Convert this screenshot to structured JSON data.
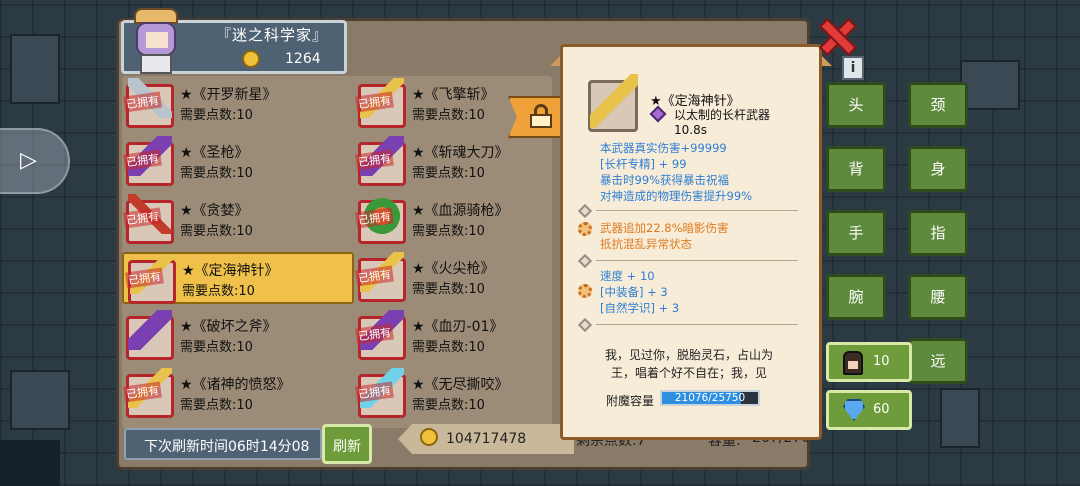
{
  "player": {
    "title": "『迷之科学家』",
    "points": "1264"
  },
  "items": [
    {
      "name": "★《开罗新星》",
      "cost": "需要点数:10",
      "owned": "已拥有",
      "weapon": "w-silver"
    },
    {
      "name": "★《飞擎斩》",
      "cost": "需要点数:10",
      "owned": "已拥有",
      "weapon": "w-gold"
    },
    {
      "name": "★《圣枪》",
      "cost": "需要点数:10",
      "owned": "已拥有",
      "weapon": "w-purple"
    },
    {
      "name": "★《斩魂大刀》",
      "cost": "需要点数:10",
      "owned": "已拥有",
      "weapon": "w-purple"
    },
    {
      "name": "★《贪婪》",
      "cost": "需要点数:10",
      "owned": "已拥有",
      "weapon": "w-red"
    },
    {
      "name": "★《血源骑枪》",
      "cost": "需要点数:10",
      "owned": "已拥有",
      "weapon": "w-green"
    },
    {
      "name": "★《定海神针》",
      "cost": "需要点数:10",
      "owned": "已拥有",
      "weapon": "w-gold"
    },
    {
      "name": "★《火尖枪》",
      "cost": "需要点数:10",
      "owned": "已拥有",
      "weapon": "w-gold"
    },
    {
      "name": "★《破坏之斧》",
      "cost": "需要点数:10",
      "owned": "",
      "weapon": "w-purple"
    },
    {
      "name": "★《血刃-01》",
      "cost": "需要点数:10",
      "owned": "已拥有",
      "weapon": "w-purple"
    },
    {
      "name": "★《诸神的愤怒》",
      "cost": "需要点数:10",
      "owned": "已拥有",
      "weapon": "w-gold"
    },
    {
      "name": "★《无尽撕咬》",
      "cost": "需要点数:10",
      "owned": "已拥有",
      "weapon": "w-ice"
    }
  ],
  "footer": {
    "refresh_time": "下次刷新时间06时14分08",
    "refresh_button": "刷新",
    "gold": "104717478",
    "remaining_points": "剩余点数:7",
    "capacity_label": "容量:",
    "capacity_value": "267/270"
  },
  "detail": {
    "title": "★《定海神针》",
    "type": "以太制的长杆武器",
    "speed": "10.8s",
    "stats": [
      {
        "text": "本武器真实伤害+99999",
        "color": "blue"
      },
      {
        "text": "[长杆专精] + 99",
        "color": "blue"
      },
      {
        "text": "暴击时99%获得暴击祝福",
        "color": "blue"
      },
      {
        "text": "对神造成的物理伤害提升99%",
        "color": "blue"
      },
      {
        "text": "武器追加22.8%暗影伤害",
        "color": "orange"
      },
      {
        "text": "抵抗混乱异常状态",
        "color": "orange"
      },
      {
        "text": "速度 + 10",
        "color": "blue"
      },
      {
        "text": "[中装备] + 3",
        "color": "blue"
      },
      {
        "text": "[自然学识] + 3",
        "color": "blue"
      }
    ],
    "flavor": "我，见过你，脱胎灵石，占山为王，唱着个好不自在；我，见",
    "enchant_label": "附魔容量",
    "enchant_value": "21076/25750",
    "enchant_fraction": 0.8185
  },
  "equipment": {
    "head": "头",
    "neck": "颈",
    "back": "背",
    "body": "身",
    "hand": "手",
    "finger": "指",
    "wrist": "腕",
    "waist": "腰",
    "ranged": "远"
  },
  "side_stats": {
    "characters": "10",
    "gems": "60"
  }
}
